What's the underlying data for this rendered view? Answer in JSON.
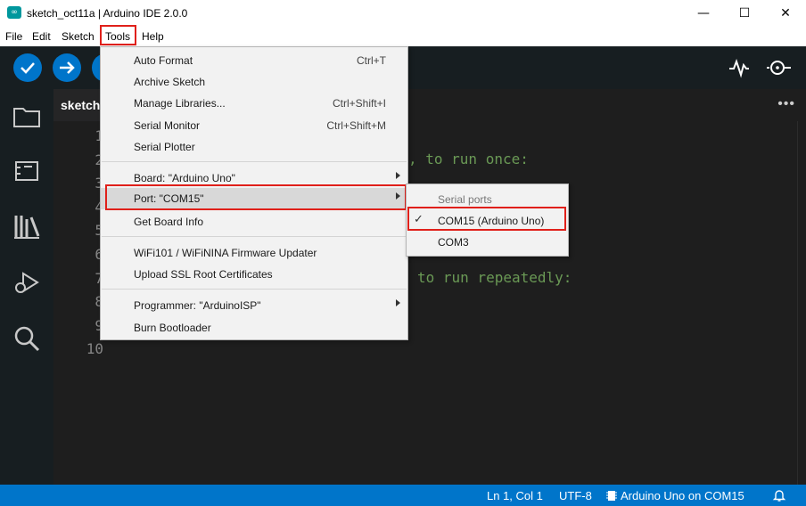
{
  "window": {
    "title": "sketch_oct11a | Arduino IDE 2.0.0",
    "logo_glyph": "∞",
    "minimize_glyph": "—",
    "maximize_glyph": "☐",
    "close_glyph": "✕"
  },
  "menubar": {
    "items": [
      "File",
      "Edit",
      "Sketch",
      "Tools",
      "Help"
    ]
  },
  "tab": {
    "label": "sketch"
  },
  "editor": {
    "line_numbers": [
      "1",
      "2",
      "3",
      "4",
      "5",
      "6",
      "7",
      "8",
      "9",
      "10"
    ],
    "visible_code_1": ", to run once:",
    "visible_code_2": "to run repeatedly:"
  },
  "tools_menu": {
    "items": [
      {
        "label": "Auto Format",
        "shortcut": "Ctrl+T"
      },
      {
        "label": "Archive Sketch",
        "shortcut": ""
      },
      {
        "label": "Manage Libraries...",
        "shortcut": "Ctrl+Shift+I"
      },
      {
        "label": "Serial Monitor",
        "shortcut": "Ctrl+Shift+M"
      },
      {
        "label": "Serial Plotter",
        "shortcut": ""
      },
      {
        "label": "Board: \"Arduino Uno\"",
        "shortcut": ""
      },
      {
        "label": "Port: \"COM15\"",
        "shortcut": ""
      },
      {
        "label": "Get Board Info",
        "shortcut": ""
      },
      {
        "label": "WiFi101 / WiFiNINA Firmware Updater",
        "shortcut": ""
      },
      {
        "label": "Upload SSL Root Certificates",
        "shortcut": ""
      },
      {
        "label": "Programmer: \"ArduinoISP\"",
        "shortcut": ""
      },
      {
        "label": "Burn Bootloader",
        "shortcut": ""
      }
    ]
  },
  "port_submenu": {
    "header": "Serial ports",
    "items": [
      "COM15 (Arduino Uno)",
      "COM3"
    ],
    "selected_index": 0
  },
  "statusbar": {
    "position": "Ln 1, Col 1",
    "encoding": "UTF-8",
    "board": "Arduino Uno on COM15"
  },
  "colors": {
    "accent": "#0075ca",
    "highlight_box": "#e0201a",
    "comment_green": "#6a9955"
  }
}
